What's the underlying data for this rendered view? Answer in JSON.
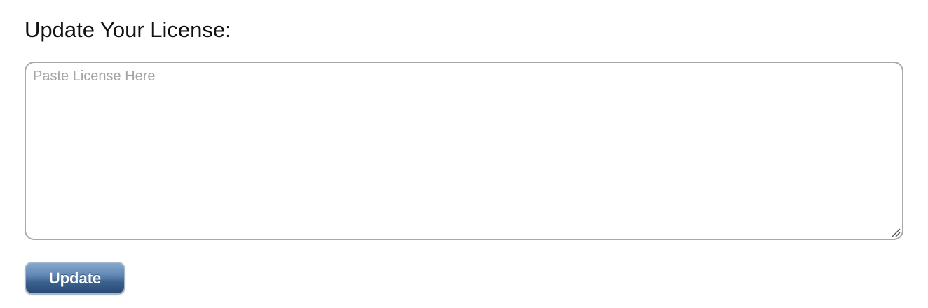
{
  "heading": "Update Your License:",
  "license_field": {
    "placeholder": "Paste License Here",
    "value": ""
  },
  "update_button": {
    "label": "Update"
  },
  "icons": {
    "resize_grip": "resize-grip-icon"
  },
  "colors": {
    "button_top": "#86a8cf",
    "button_bottom": "#284a74",
    "field_border": "#a9a9a9",
    "placeholder": "#a3a3a3"
  }
}
